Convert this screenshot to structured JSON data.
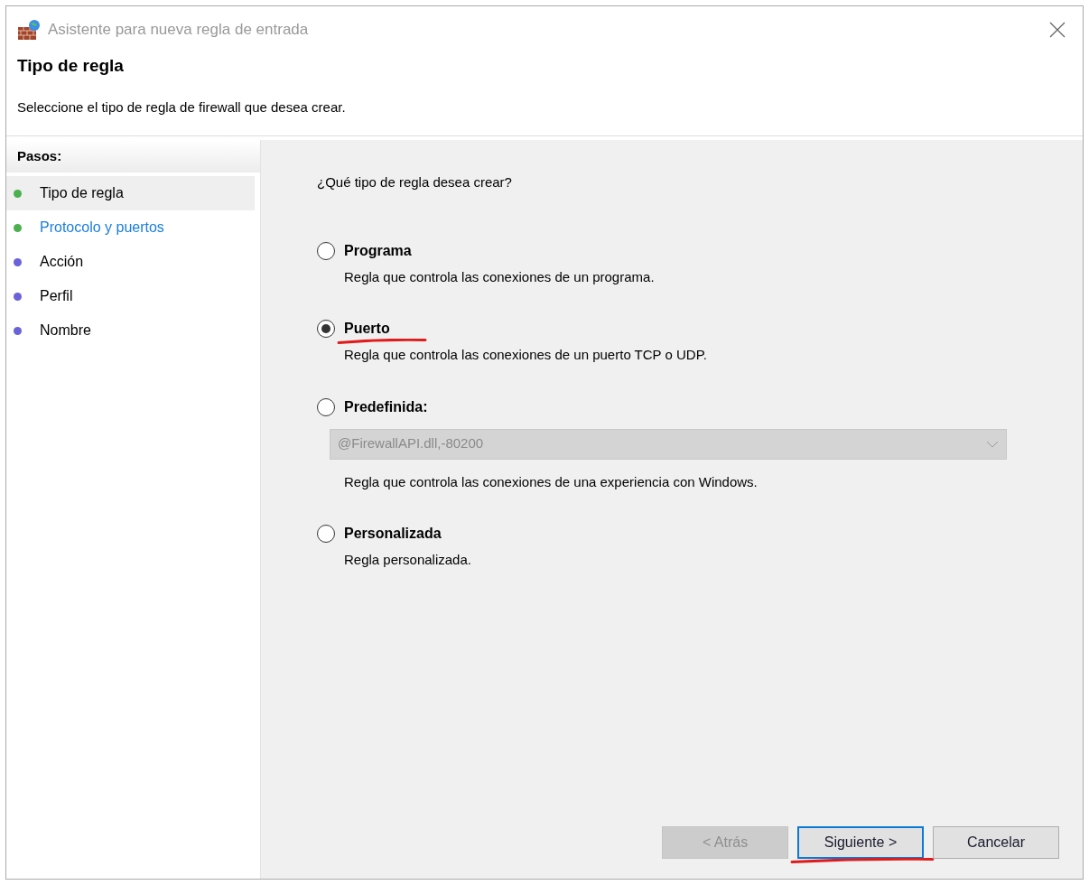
{
  "window": {
    "title": "Asistente para nueva regla de entrada"
  },
  "header": {
    "title": "Tipo de regla",
    "subtitle": "Seleccione el tipo de regla de firewall que desea crear."
  },
  "steps": {
    "title": "Pasos:",
    "items": [
      {
        "label": "Tipo de regla",
        "color": "#4caf50",
        "selected": true,
        "link": false
      },
      {
        "label": "Protocolo y puertos",
        "color": "#4caf50",
        "selected": false,
        "link": true
      },
      {
        "label": "Acción",
        "color": "#6a62d8",
        "selected": false,
        "link": false
      },
      {
        "label": "Perfil",
        "color": "#6a62d8",
        "selected": false,
        "link": false
      },
      {
        "label": "Nombre",
        "color": "#6a62d8",
        "selected": false,
        "link": false
      }
    ]
  },
  "question": "¿Qué tipo de regla desea crear?",
  "options": [
    {
      "kind": "plain",
      "label": "Programa",
      "description": "Regla que controla las conexiones de un programa.",
      "selected": false,
      "underlined": false
    },
    {
      "kind": "plain",
      "label": "Puerto",
      "description": "Regla que controla las conexiones de un puerto TCP o UDP.",
      "selected": true,
      "underlined": true
    },
    {
      "kind": "dropdown",
      "label": "Predefinida:",
      "dropdown": {
        "value": "@FirewallAPI.dll,-80200",
        "disabled": true
      },
      "description": "Regla que controla las conexiones de una experiencia con Windows.",
      "selected": false,
      "underlined": false
    },
    {
      "kind": "plain",
      "label": "Personalizada",
      "description": "Regla personalizada.",
      "selected": false,
      "underlined": false
    }
  ],
  "buttons": [
    {
      "label": "< Atrás",
      "disabled": true,
      "default": false,
      "underlined": false
    },
    {
      "label": "Siguiente >",
      "disabled": false,
      "default": true,
      "underlined": true
    },
    {
      "label": "Cancelar",
      "disabled": false,
      "default": false,
      "underlined": false
    }
  ]
}
